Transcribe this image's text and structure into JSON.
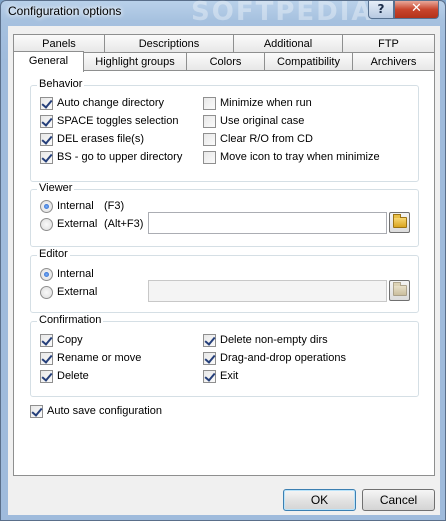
{
  "window": {
    "title": "Configuration options",
    "watermark": "SOFTPEDIA",
    "help": "?",
    "close": "✕"
  },
  "tabs_row1": [
    "Panels",
    "Descriptions",
    "Additional",
    "FTP"
  ],
  "tabs_row2": [
    "General",
    "Highlight groups",
    "Colors",
    "Compatibility",
    "Archivers"
  ],
  "active_tab": "General",
  "behavior": {
    "label": "Behavior",
    "left": [
      {
        "label": "Auto change directory",
        "checked": true
      },
      {
        "label": "SPACE toggles selection",
        "checked": true
      },
      {
        "label": "DEL erases file(s)",
        "checked": true
      },
      {
        "label": "BS - go to upper directory",
        "checked": true
      }
    ],
    "right": [
      {
        "label": "Minimize when run",
        "checked": false
      },
      {
        "label": "Use original case",
        "checked": false
      },
      {
        "label": "Clear R/O from CD",
        "checked": false
      },
      {
        "label": "Move icon to tray when minimize",
        "checked": false
      }
    ]
  },
  "viewer": {
    "label": "Viewer",
    "internal": "Internal",
    "internal_hint": "(F3)",
    "external": "External",
    "external_hint": "(Alt+F3)",
    "selected": "internal",
    "path_value": ""
  },
  "editor": {
    "label": "Editor",
    "internal": "Internal",
    "external": "External",
    "selected": "internal",
    "path_value": ""
  },
  "confirmation": {
    "label": "Confirmation",
    "left": [
      {
        "label": "Copy",
        "checked": true
      },
      {
        "label": "Rename or move",
        "checked": true
      },
      {
        "label": "Delete",
        "checked": true
      }
    ],
    "right": [
      {
        "label": "Delete non-empty dirs",
        "checked": true
      },
      {
        "label": "Drag-and-drop operations",
        "checked": true
      },
      {
        "label": "Exit",
        "checked": true
      }
    ]
  },
  "auto_save": {
    "label": "Auto save configuration",
    "checked": true
  },
  "buttons": {
    "ok": "OK",
    "cancel": "Cancel"
  }
}
